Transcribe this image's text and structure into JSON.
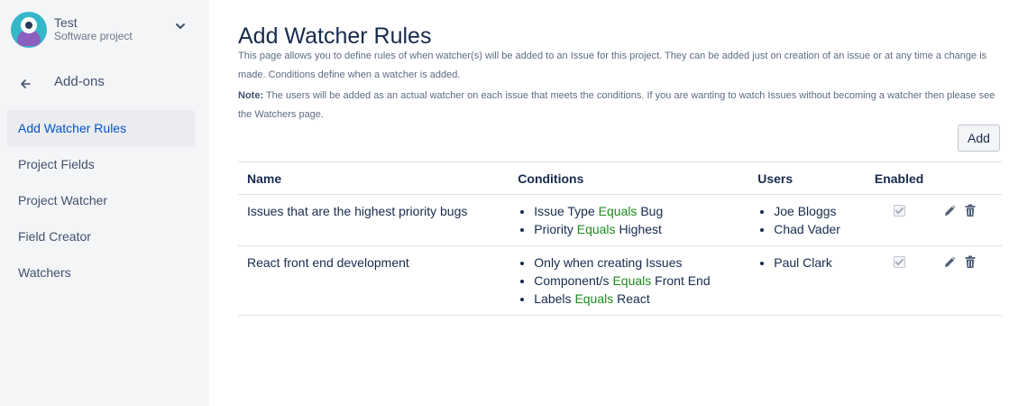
{
  "sidebar": {
    "project_name": "Test",
    "project_type": "Software project",
    "back_label": "Add-ons",
    "items": [
      {
        "label": "Add Watcher Rules",
        "active": true
      },
      {
        "label": "Project Fields",
        "active": false
      },
      {
        "label": "Project Watcher",
        "active": false
      },
      {
        "label": "Field Creator",
        "active": false
      },
      {
        "label": "Watchers",
        "active": false
      }
    ]
  },
  "main": {
    "title": "Add Watcher Rules",
    "description": "This page allows you to define rules of when watcher(s) will be added to an Issue for this project. They can be added just on creation of an issue or at any time a change is made. Conditions define when a watcher is added.",
    "note_label": "Note:",
    "note_text": " The users will be added as an actual watcher on each issue that meets the conditions. If you are wanting to watch Issues without becoming a watcher then please see the Watchers page.",
    "add_button": "Add"
  },
  "table": {
    "headers": {
      "name": "Name",
      "conditions": "Conditions",
      "users": "Users",
      "enabled": "Enabled"
    },
    "rows": [
      {
        "name": "Issues that are the highest priority bugs",
        "conditions": [
          {
            "field": "Issue Type",
            "op": "Equals",
            "value": "Bug"
          },
          {
            "field": "Priority",
            "op": "Equals",
            "value": "Highest"
          }
        ],
        "users": [
          "Joe Bloggs",
          "Chad Vader"
        ],
        "enabled": true
      },
      {
        "name": "React front end development",
        "conditions": [
          {
            "field": "Only when creating Issues"
          },
          {
            "field": "Component/s",
            "op": "Equals",
            "value": "Front End"
          },
          {
            "field": "Labels",
            "op": "Equals",
            "value": "React"
          }
        ],
        "users": [
          "Paul Clark"
        ],
        "enabled": true
      }
    ]
  },
  "icons": {
    "edit": "pencil-icon",
    "delete": "trash-icon",
    "back": "arrow-left-icon",
    "expand": "chevron-down-icon"
  },
  "colors": {
    "sidebar_bg": "#f4f5f7",
    "active_item_bg": "#ebecf0",
    "active_item_text": "#0052cc",
    "operator_text": "#1e8a1e"
  }
}
